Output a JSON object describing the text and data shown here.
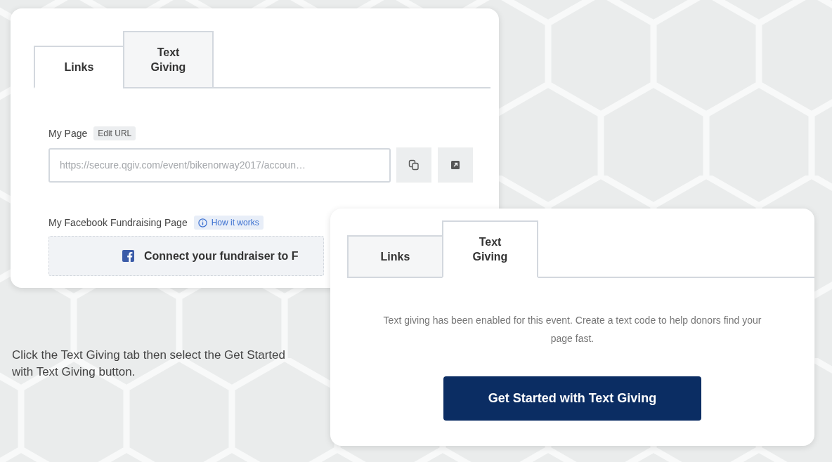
{
  "links_card": {
    "tabs": [
      {
        "label": "Links",
        "selected": true
      },
      {
        "label": "Text Giving",
        "selected": false
      }
    ],
    "my_page": {
      "label": "My Page",
      "edit_badge": "Edit URL",
      "url": "https://secure.qgiv.com/event/bikenorway2017/accoun…"
    },
    "facebook": {
      "label": "My Facebook Fundraising Page",
      "help_link": "How it works",
      "connect_button": "Connect your fundraiser to F"
    }
  },
  "instruction": "Click the Text Giving tab then select the Get Started with Text Giving button.",
  "text_giving_card": {
    "tabs": [
      {
        "label": "Links",
        "selected": false
      },
      {
        "label": "Text Giving",
        "selected": true
      }
    ],
    "message": "Text giving has been enabled for this event. Create a text code to help donors find your page fast.",
    "button": "Get Started with Text Giving"
  }
}
